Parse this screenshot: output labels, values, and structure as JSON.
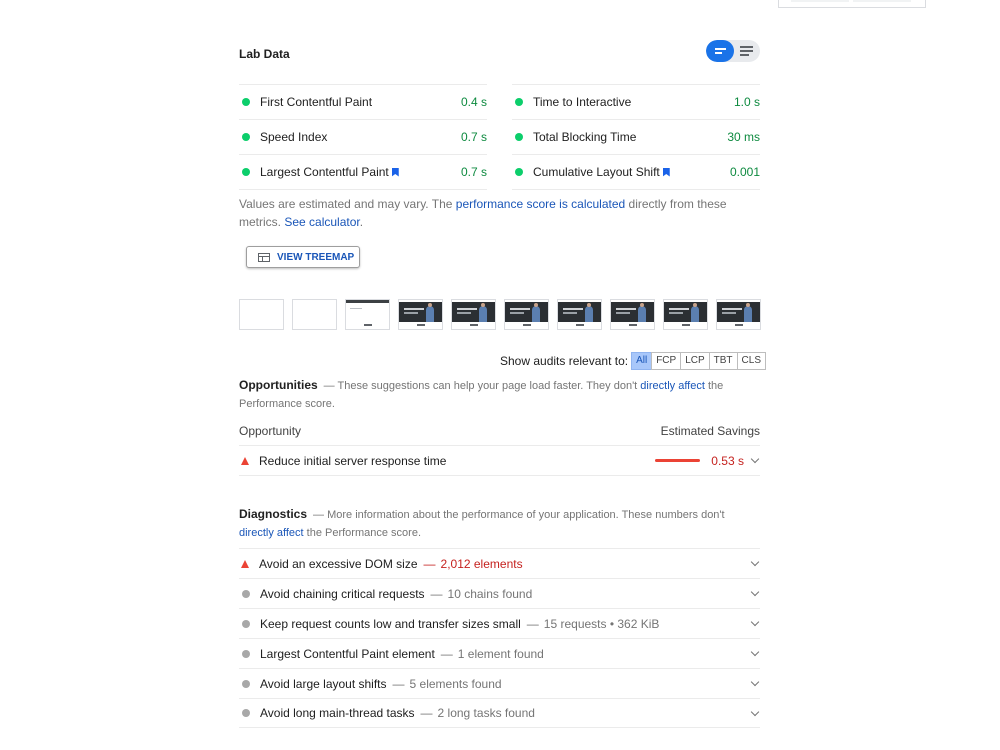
{
  "lab_data": {
    "title": "Lab Data",
    "metrics_left": [
      {
        "name": "First Contentful Paint",
        "value": "0.4 s",
        "status": "pass"
      },
      {
        "name": "Speed Index",
        "value": "0.7 s",
        "status": "pass"
      },
      {
        "name": "Largest Contentful Paint",
        "value": "0.7 s",
        "status": "pass",
        "bookmark": true
      }
    ],
    "metrics_right": [
      {
        "name": "Time to Interactive",
        "value": "1.0 s",
        "status": "pass"
      },
      {
        "name": "Total Blocking Time",
        "value": "30 ms",
        "status": "pass"
      },
      {
        "name": "Cumulative Layout Shift",
        "value": "0.001",
        "status": "pass",
        "bookmark": true
      }
    ],
    "note": {
      "prefix": "Values are estimated and may vary. The ",
      "link1": "performance score is calculated",
      "middle": " directly from these metrics. ",
      "link2": "See calculator",
      "suffix": "."
    },
    "treemap_button": "VIEW TREEMAP"
  },
  "filter": {
    "label": "Show audits relevant to:",
    "chips": [
      "All",
      "FCP",
      "LCP",
      "TBT",
      "CLS"
    ],
    "active": "All"
  },
  "opportunities": {
    "title": "Opportunities",
    "desc_prefix": "— These suggestions can help your page load faster. They don't ",
    "desc_link": "directly affect",
    "desc_suffix": " the Performance score.",
    "col_left": "Opportunity",
    "col_right": "Estimated Savings",
    "items": [
      {
        "title": "Reduce initial server response time",
        "savings": "0.53 s",
        "severity": "fail"
      }
    ]
  },
  "diagnostics": {
    "title": "Diagnostics",
    "desc_prefix": "— More information about the performance of your application. These numbers don't ",
    "desc_link": "directly affect",
    "desc_suffix": " the Performance score.",
    "items": [
      {
        "title": "Avoid an excessive DOM size",
        "detail": "2,012 elements",
        "severity": "fail"
      },
      {
        "title": "Avoid chaining critical requests",
        "detail": "10 chains found",
        "severity": "info"
      },
      {
        "title": "Keep request counts low and transfer sizes small",
        "detail": "15 requests • 362 KiB",
        "severity": "info"
      },
      {
        "title": "Largest Contentful Paint element",
        "detail": "1 element found",
        "severity": "info"
      },
      {
        "title": "Avoid large layout shifts",
        "detail": "5 elements found",
        "severity": "info"
      },
      {
        "title": "Avoid long main-thread tasks",
        "detail": "2 long tasks found",
        "severity": "info"
      }
    ]
  },
  "colors": {
    "pass": "#0cce6b",
    "fail": "#eb4335",
    "info": "#a8a8a8",
    "link": "#1a56b8",
    "toggle_active": "#1a73e8"
  }
}
